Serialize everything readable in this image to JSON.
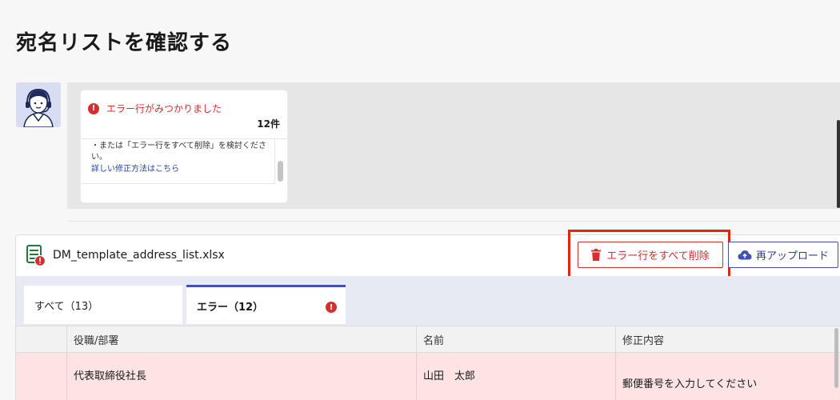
{
  "page": {
    "title": "宛名リストを確認する"
  },
  "assistant": {
    "message_title": "エラー行がみつかりました",
    "error_count": "12件",
    "body_text": "・または「エラー行をすべて削除」を検討ください。",
    "help_link": "詳しい修正方法はこちら"
  },
  "file": {
    "name": "DM_template_address_list.xlsx",
    "delete_all_label": "エラー行をすべて削除",
    "reupload_label": "再アップロード"
  },
  "tabs": [
    {
      "label": "すべて（13）"
    },
    {
      "label": "エラー（12）"
    }
  ],
  "table": {
    "columns": [
      "役職/部署",
      "名前",
      "修正内容"
    ],
    "rows": [
      {
        "role": "代表取締役社長",
        "name": "山田　太郎",
        "fix": "郵便番号を入力してください"
      }
    ]
  },
  "colors": {
    "error": "#d32f2f",
    "accent": "#3f51b5",
    "highlight": "#e2260c",
    "error_row": "#fde3e3"
  },
  "icons": [
    "operator-avatar",
    "error-icon",
    "excel-file-error-icon",
    "trash-icon",
    "cloud-upload-icon"
  ]
}
